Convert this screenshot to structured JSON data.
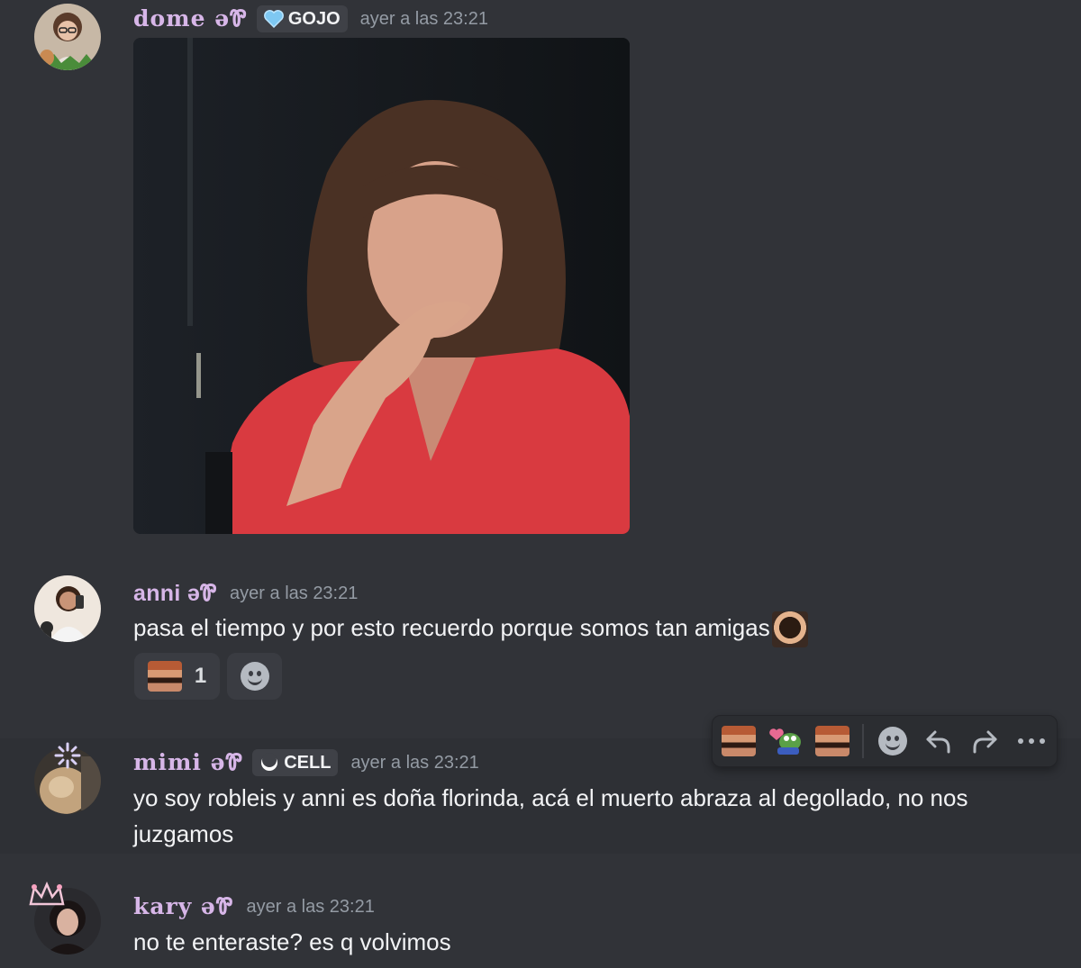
{
  "messages": [
    {
      "username": "dome əᏈ",
      "tag": {
        "label": "GOJO",
        "icon": "blue-heart-icon"
      },
      "timestamp": "ayer a las 23:21",
      "attachment": "gif-image"
    },
    {
      "username": "anni əᏈ",
      "timestamp": "ayer a las 23:21",
      "text": "pasa el tiempo y por esto recuerdo porque somos tan amigas",
      "inline_emoji": "laughing-man-emoji",
      "reactions": [
        {
          "emoji": "laughing-mustache-emoji",
          "count": "1"
        }
      ]
    },
    {
      "username": "mimi əᏈ",
      "tag": {
        "label": "CELL",
        "icon": "crescent-icon"
      },
      "timestamp": "ayer a las 23:21",
      "text_line1": "yo soy robleis y anni es doña florinda, acá el muerto abraza al degollado, no nos",
      "text_line2": "juzgamos"
    },
    {
      "username": "kary əᏈ",
      "timestamp": "ayer a las 23:21",
      "text": "no te enteraste? es q volvimos"
    }
  ],
  "hover_toolbar": {
    "items": [
      "laughing-mustache-emoji",
      "pepe-heart-emoji",
      "laughing-mustache-emoji-2",
      "add-reaction-icon",
      "reply-icon",
      "forward-icon",
      "more-icon"
    ]
  },
  "colors": {
    "background": "#313338",
    "hover_background": "#2e3035",
    "username": "#d7b6e8",
    "timestamp": "#949ba4",
    "text": "#f2f3f5"
  }
}
